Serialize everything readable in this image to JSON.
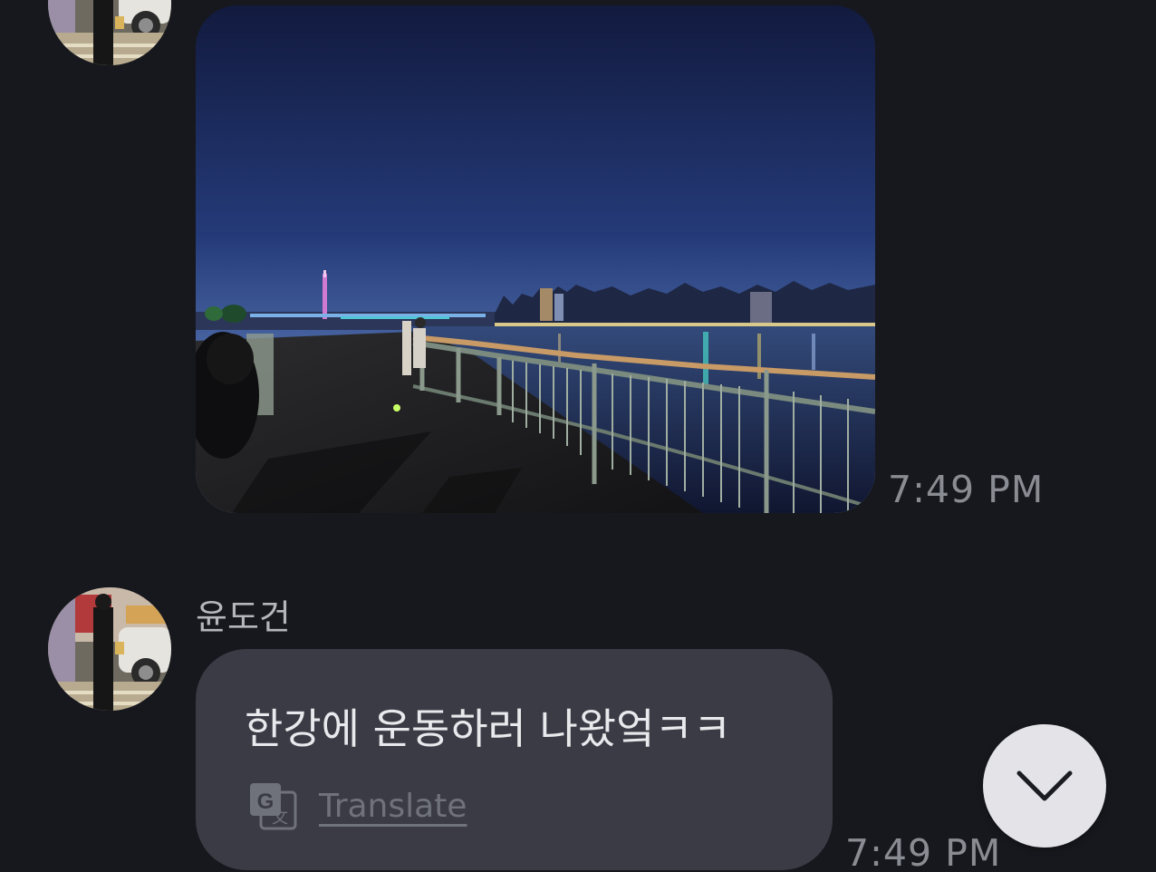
{
  "messages": [
    {
      "type": "photo",
      "timestamp": "7:49 PM"
    },
    {
      "type": "text",
      "sender": "윤도건",
      "text": "한강에 운동하러 나왔엌ㅋㅋ",
      "translate_label": "Translate",
      "timestamp": "7:49 PM"
    }
  ],
  "icons": {
    "translate": "google-translate-icon",
    "scroll_down": "chevron-down-icon"
  },
  "colors": {
    "background": "#17181d",
    "bubble": "#3a3b45",
    "scroll_button": "#e4e4e8"
  }
}
